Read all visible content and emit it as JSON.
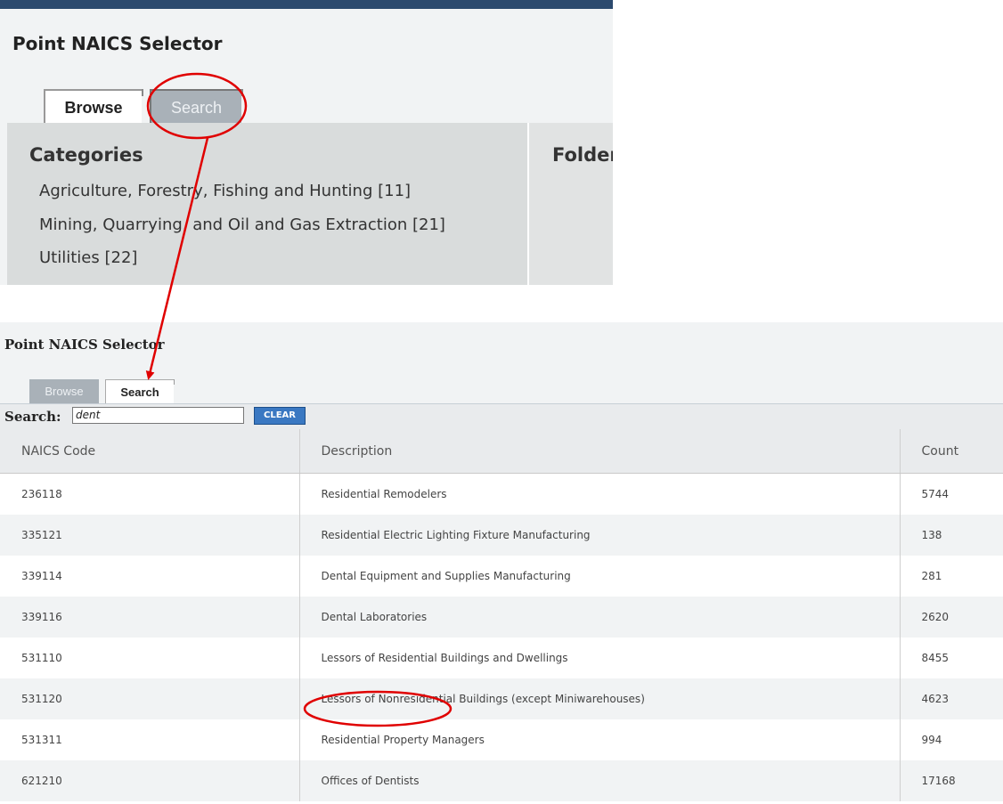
{
  "top": {
    "title": "Point NAICS Selector",
    "tabs": {
      "browse": "Browse",
      "search": "Search"
    },
    "categories_heading": "Categories",
    "folder_heading": "Folder",
    "categories": [
      "Agriculture, Forestry, Fishing and Hunting [11]",
      "Mining, Quarrying, and Oil and Gas Extraction [21]",
      "Utilities [22]",
      ""
    ]
  },
  "bottom": {
    "title": "Point NAICS Selector",
    "tabs": {
      "browse": "Browse",
      "search": "Search"
    },
    "search_label": "Search:",
    "search_value": "dent",
    "clear_label": "CLEAR",
    "columns": [
      "NAICS Code",
      "Description",
      "Count"
    ],
    "rows": [
      {
        "code": "236118",
        "description": "Residential Remodelers",
        "count": "5744"
      },
      {
        "code": "335121",
        "description": "Residential Electric Lighting Fixture Manufacturing",
        "count": "138"
      },
      {
        "code": "339114",
        "description": "Dental Equipment and Supplies Manufacturing",
        "count": "281"
      },
      {
        "code": "339116",
        "description": "Dental Laboratories",
        "count": "2620"
      },
      {
        "code": "531110",
        "description": "Lessors of Residential Buildings and Dwellings",
        "count": "8455"
      },
      {
        "code": "531120",
        "description": "Lessors of Nonresidential Buildings (except Miniwarehouses)",
        "count": "4623"
      },
      {
        "code": "531311",
        "description": "Residential Property Managers",
        "count": "994"
      },
      {
        "code": "621210",
        "description": "Offices of Dentists",
        "count": "17168"
      }
    ]
  },
  "colors": {
    "annotation": "#e00000",
    "active_tab": "#ffffff",
    "inactive_tab": "#a9b1b8",
    "clear_button": "#3a78c2"
  }
}
